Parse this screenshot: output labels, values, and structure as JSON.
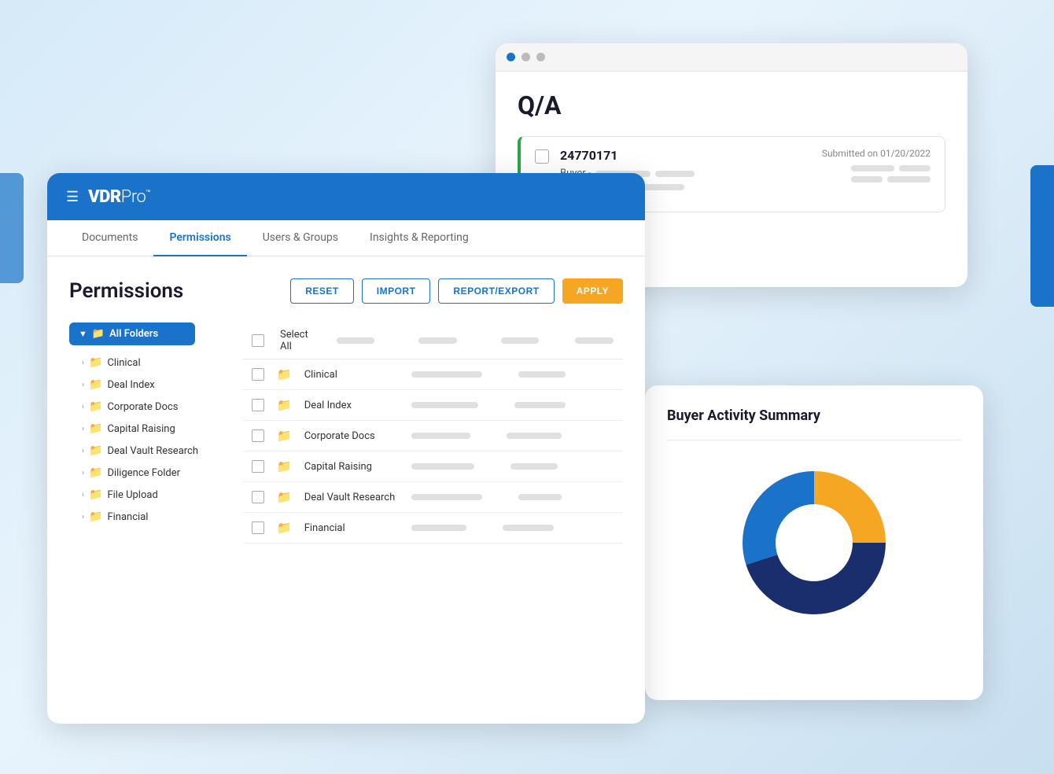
{
  "background": "#d6eaf8",
  "app": {
    "logo_vdr": "VDR",
    "logo_pro": "Pro",
    "logo_tm": "™"
  },
  "nav": {
    "tabs": [
      {
        "label": "Documents",
        "active": false
      },
      {
        "label": "Permissions",
        "active": true
      },
      {
        "label": "Users & Groups",
        "active": false
      },
      {
        "label": "Insights & Reporting",
        "active": false
      }
    ]
  },
  "permissions": {
    "title": "Permissions",
    "buttons": {
      "reset": "RESET",
      "import": "IMPORT",
      "report_export": "REPORT/EXPORT",
      "apply": "APPLY"
    },
    "all_folders_label": "All Folders",
    "select_all_label": "Select All",
    "folders": [
      {
        "name": "Clinical"
      },
      {
        "name": "Deal Index"
      },
      {
        "name": "Corporate Docs"
      },
      {
        "name": "Capital Raising"
      },
      {
        "name": "Deal Vault Research"
      },
      {
        "name": "Diligence Folder"
      },
      {
        "name": "File Upload"
      },
      {
        "name": "Financial"
      }
    ],
    "table_rows": [
      {
        "name": "Clinical"
      },
      {
        "name": "Deal Index"
      },
      {
        "name": "Corporate Docs"
      },
      {
        "name": "Capital Raising"
      },
      {
        "name": "Deal Vault Research"
      },
      {
        "name": "Financial"
      }
    ]
  },
  "qa": {
    "title": "Q/A",
    "card": {
      "id": "24770171",
      "submitted_label": "Submitted on 01/20/2022",
      "buyer_prefix": "Buyer -"
    }
  },
  "buyer_activity": {
    "title": "Buyer Activity Summary",
    "chart": {
      "segments": [
        {
          "color": "#f5a623",
          "value": 25
        },
        {
          "color": "#1a73c8",
          "value": 30
        },
        {
          "color": "#1a2e6e",
          "value": 45
        }
      ]
    }
  }
}
